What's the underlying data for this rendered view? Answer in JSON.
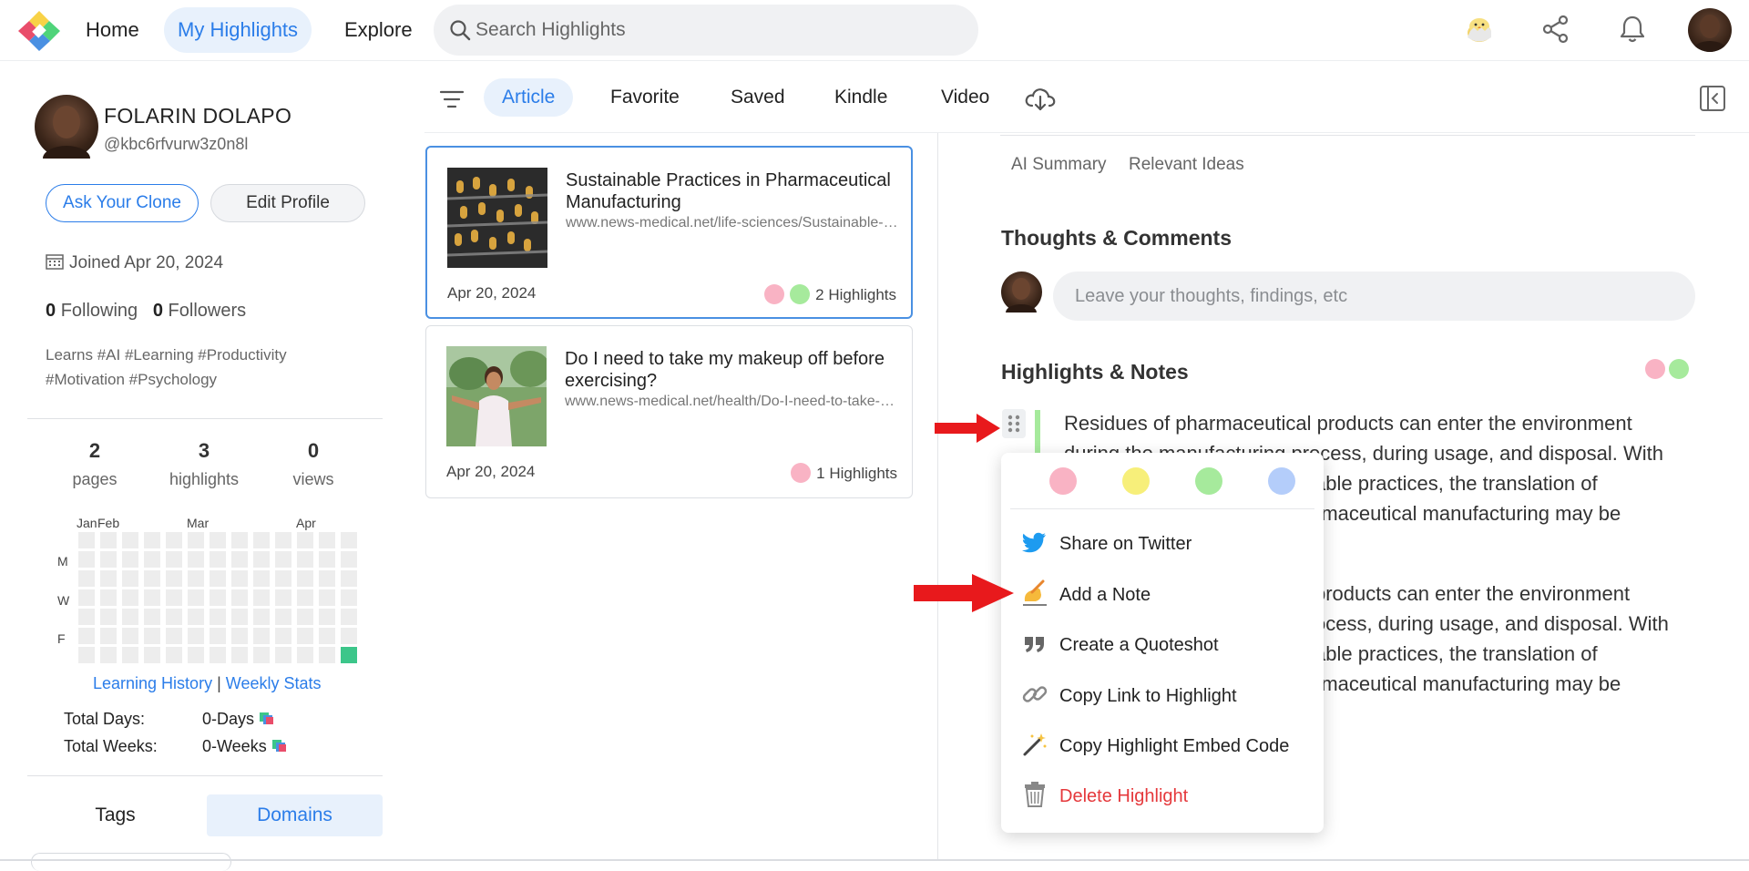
{
  "nav": {
    "home": "Home",
    "my_highlights": "My Highlights",
    "explore": "Explore",
    "search_placeholder": "Search Highlights"
  },
  "profile": {
    "name": "FOLARIN DOLAPO",
    "handle": "@kbc6rfvurw3z0n8l",
    "ask_clone": "Ask Your Clone",
    "edit_profile": "Edit Profile",
    "joined": "Joined Apr 20, 2024",
    "following_count": "0",
    "following_label": "Following",
    "followers_count": "0",
    "followers_label": "Followers",
    "learns": "Learns #AI #Learning #Productivity #Motivation #Psychology"
  },
  "stats": [
    {
      "num": "2",
      "label": "pages"
    },
    {
      "num": "3",
      "label": "highlights"
    },
    {
      "num": "0",
      "label": "views"
    }
  ],
  "activity": {
    "months": [
      "Jan",
      "Feb",
      "Mar",
      "Apr"
    ],
    "days": [
      "M",
      "W",
      "F"
    ],
    "active_color": "#3cc68a",
    "history_link": "Learning History",
    "separator": "|",
    "weekly_link": "Weekly Stats",
    "total_days_label": "Total Days:",
    "total_days_value": "0-Days",
    "total_weeks_label": "Total Weeks:",
    "total_weeks_value": "0-Weeks"
  },
  "bottom_tabs": {
    "tags": "Tags",
    "domains": "Domains"
  },
  "categories": [
    "Article",
    "Favorite",
    "Saved",
    "Kindle",
    "Video"
  ],
  "cards": [
    {
      "title": "Sustainable Practices in Pharmaceutical Manufacturing",
      "url": "www.news-medical.net/life-sciences/Sustainable-Practices-in-Pharmaceutical-Manufacturing",
      "date": "Apr 20, 2024",
      "highlights": "2 Highlights"
    },
    {
      "title": "Do I need to take my makeup off before exercising?",
      "url": "www.news-medical.net/health/Do-I-need-to-take-my-makeup-off-before-exercising",
      "date": "Apr 20, 2024",
      "highlights": "1 Highlights"
    }
  ],
  "right": {
    "ai_summary": "AI Summary",
    "relevant_ideas": "Relevant Ideas",
    "thoughts_title": "Thoughts & Comments",
    "comment_placeholder": "Leave your thoughts, findings, etc",
    "highlights_title": "Highlights & Notes",
    "hl1_lines": [
      "Residues of pharmaceutical products can enter the environment",
      "during the manufacturing process, during usage, and disposal. With",
      "able practices, the translation of",
      "rmaceutical manufacturing may be"
    ],
    "hl2_lines": [
      "products can enter the environment",
      "ocess, during usage, and disposal. With",
      "able practices, the translation of",
      "rmaceutical manufacturing may be"
    ]
  },
  "menu": {
    "colors": [
      "#f9b3c4",
      "#f7ef7a",
      "#a6ea9c",
      "#b4cdfa"
    ],
    "items": [
      {
        "label": "Share on Twitter",
        "icon": "twitter-icon"
      },
      {
        "label": "Add a Note",
        "icon": "writing-hand-icon"
      },
      {
        "label": "Create a Quoteshot",
        "icon": "quote-icon"
      },
      {
        "label": "Copy Link to Highlight",
        "icon": "link-icon"
      },
      {
        "label": "Copy Highlight Embed Code",
        "icon": "magic-wand-icon"
      },
      {
        "label": "Delete Highlight",
        "icon": "trash-icon"
      }
    ]
  },
  "colors": {
    "accent": "#2b7de9",
    "highlight_pink": "#f9b3c4",
    "highlight_green": "#a6ea9c",
    "danger": "#e5383b",
    "arrow_red": "#e8191c"
  }
}
